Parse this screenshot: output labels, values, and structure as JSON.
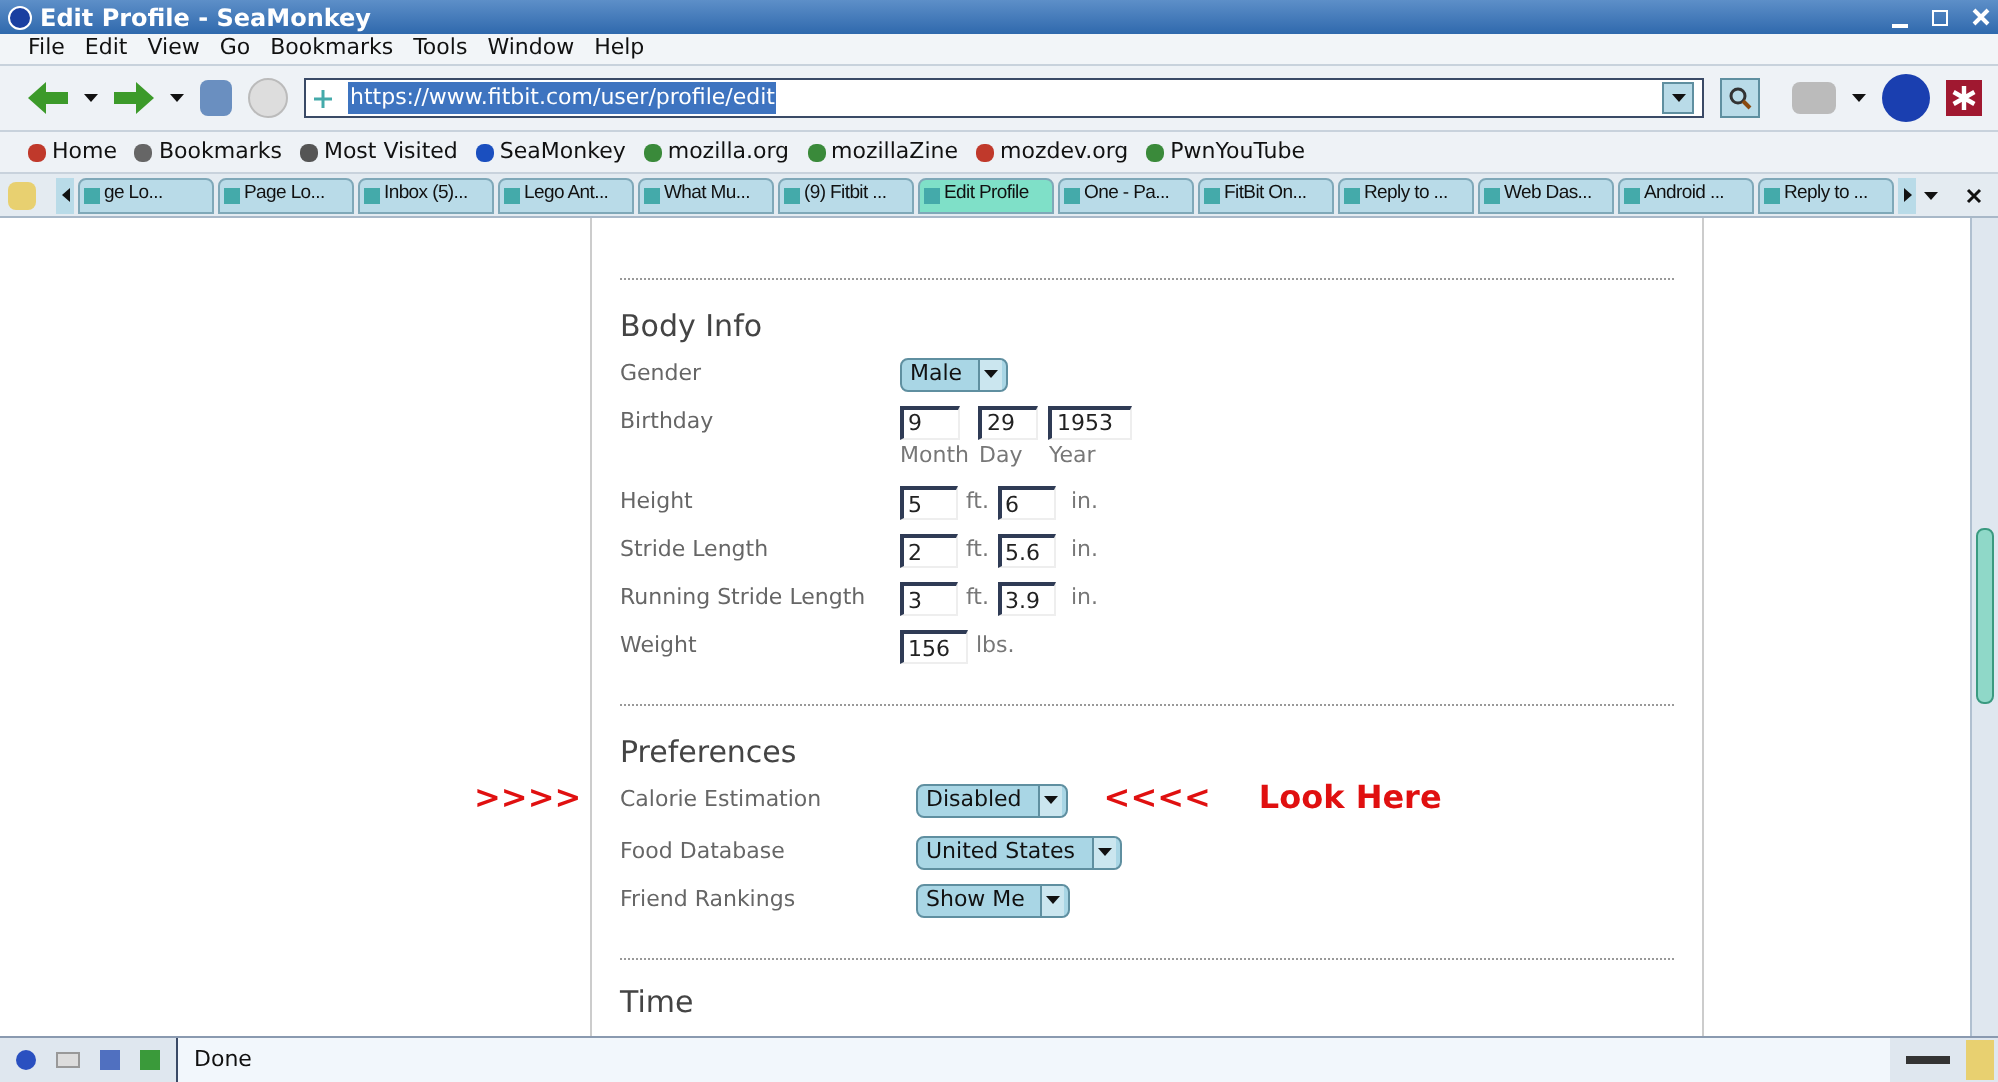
{
  "window": {
    "title": "Edit Profile - SeaMonkey"
  },
  "menu": [
    "File",
    "Edit",
    "View",
    "Go",
    "Bookmarks",
    "Tools",
    "Window",
    "Help"
  ],
  "address": {
    "value": "https://www.fitbit.com/user/profile/edit"
  },
  "bookmarks": [
    {
      "label": "Home"
    },
    {
      "label": "Bookmarks"
    },
    {
      "label": "Most Visited"
    },
    {
      "label": "SeaMonkey"
    },
    {
      "label": "mozilla.org"
    },
    {
      "label": "mozillaZine"
    },
    {
      "label": "mozdev.org"
    },
    {
      "label": "PwnYouTube"
    }
  ],
  "tabs": [
    {
      "label": "ge Lo...",
      "selected": false
    },
    {
      "label": "Page Lo...",
      "selected": false
    },
    {
      "label": "Inbox (5)...",
      "selected": false
    },
    {
      "label": "Lego Ant...",
      "selected": false
    },
    {
      "label": "What Mu...",
      "selected": false
    },
    {
      "label": "(9) Fitbit ...",
      "selected": false
    },
    {
      "label": "Edit Profile",
      "selected": true
    },
    {
      "label": "One - Pa...",
      "selected": false
    },
    {
      "label": "FitBit On...",
      "selected": false
    },
    {
      "label": "Reply to ...",
      "selected": false
    },
    {
      "label": "Web Das...",
      "selected": false
    },
    {
      "label": "Android ...",
      "selected": false
    },
    {
      "label": "Reply to ...",
      "selected": false
    }
  ],
  "body_info": {
    "title": "Body Info",
    "rows": [
      {
        "kind": "select",
        "label": "Gender",
        "value": "Male"
      },
      {
        "kind": "date",
        "label": "Birthday",
        "fields": [
          {
            "value": "9",
            "caption": "Month"
          },
          {
            "value": "29",
            "caption": "Day"
          },
          {
            "value": "1953",
            "caption": "Year"
          }
        ]
      },
      {
        "kind": "pair",
        "label": "Height",
        "first": "5",
        "first_unit": "ft.",
        "second": "6",
        "second_unit": "in."
      },
      {
        "kind": "pair",
        "label": "Stride Length",
        "first": "2",
        "first_unit": "ft.",
        "second": "5.6",
        "second_unit": "in."
      },
      {
        "kind": "pair",
        "label": "Running Stride Length",
        "first": "3",
        "first_unit": "ft.",
        "second": "3.9",
        "second_unit": "in."
      },
      {
        "kind": "single",
        "label": "Weight",
        "value": "156",
        "unit": "lbs."
      }
    ]
  },
  "preferences": {
    "title": "Preferences",
    "rows": [
      {
        "label": "Calorie Estimation",
        "value": "Disabled",
        "left_note": ">>>>",
        "right_note": "<<<<",
        "note": "Look Here"
      },
      {
        "label": "Food Database",
        "value": "United States"
      },
      {
        "label": "Friend Rankings",
        "value": "Show Me"
      }
    ]
  },
  "next_section": {
    "title": "Time"
  },
  "status_bar": {
    "text": "Done"
  }
}
